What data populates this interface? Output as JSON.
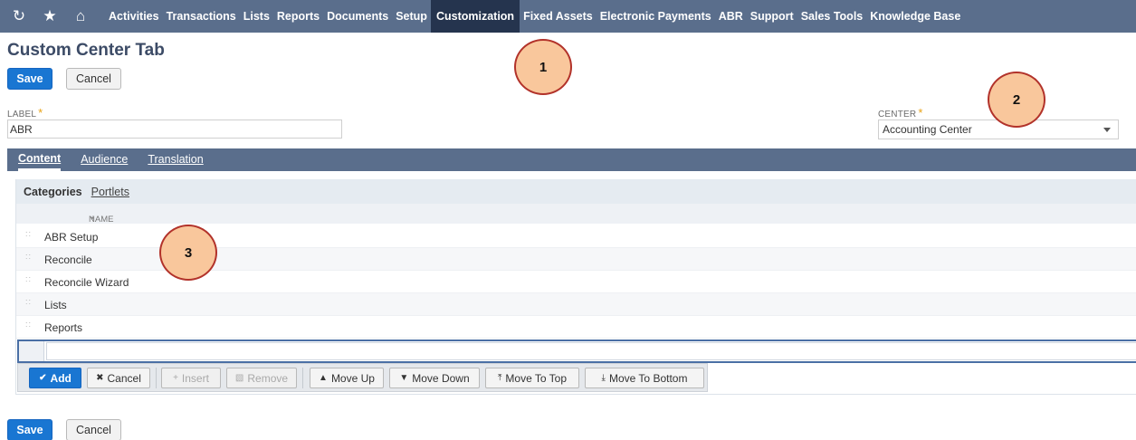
{
  "nav": {
    "icons": [
      "recent-icon",
      "star-icon",
      "home-icon"
    ],
    "items": [
      "Activities",
      "Transactions",
      "Lists",
      "Reports",
      "Documents",
      "Setup",
      "Customization",
      "Fixed Assets",
      "Electronic Payments",
      "ABR",
      "Support",
      "Sales Tools",
      "Knowledge Base"
    ],
    "active": "Customization"
  },
  "page": {
    "title": "Custom Center Tab"
  },
  "top_actions": {
    "save_label": "Save",
    "cancel_label": "Cancel"
  },
  "form": {
    "label_field": {
      "label": "LABEL",
      "value": "ABR"
    },
    "center_field": {
      "label": "CENTER",
      "value": "Accounting Center"
    }
  },
  "tabs": [
    "Content",
    "Audience",
    "Translation"
  ],
  "subtabs": [
    "Categories",
    "Portlets"
  ],
  "grid": {
    "column_header": "NAME",
    "rows": [
      "ABR Setup",
      "Reconcile",
      "Reconcile Wizard",
      "Lists",
      "Reports"
    ]
  },
  "toolbar": {
    "add": "Add",
    "cancel": "Cancel",
    "insert": "Insert",
    "remove": "Remove",
    "move_up": "Move Up",
    "move_down": "Move Down",
    "move_to_top": "Move To Top",
    "move_to_bottom": "Move To Bottom"
  },
  "bottom_actions": {
    "save_label": "Save",
    "cancel_label": "Cancel"
  },
  "callouts": [
    "1",
    "2",
    "3"
  ],
  "colors": {
    "nav_bg": "#5a6e8c",
    "nav_active": "#25344e",
    "primary": "#1976d2",
    "required": "#e8a317",
    "callout_fill": "#f9c79c",
    "callout_border": "#b2322a"
  }
}
